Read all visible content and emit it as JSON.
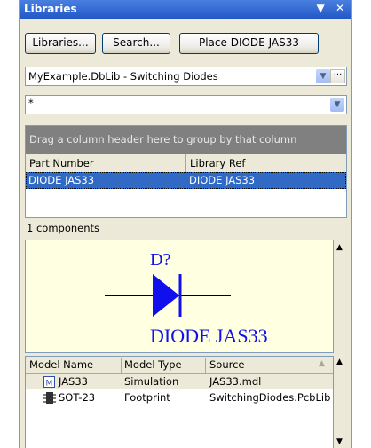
{
  "panel": {
    "title": "Libraries",
    "title_icons": "▼ ✕"
  },
  "toolbar": {
    "libraries_label": "Libraries...",
    "search_label": "Search...",
    "place_label": "Place DIODE JAS33"
  },
  "library_select": {
    "value": "MyExample.DbLib - Switching Diodes",
    "more_label": "···"
  },
  "filter_select": {
    "value": "*"
  },
  "grid": {
    "group_hint": "Drag a column header here to group by that column",
    "columns": [
      "Part Number",
      "Library Ref"
    ],
    "rows": [
      {
        "part_number": "DIODE JAS33",
        "library_ref": "DIODE JAS33"
      }
    ]
  },
  "component_count": "1 components",
  "preview": {
    "designator": "D?",
    "comment": "DIODE JAS33",
    "symbol_color": "#1010ee"
  },
  "models": {
    "columns": [
      "Model Name",
      "Model Type",
      "Source"
    ],
    "rows": [
      {
        "icon": "simulation-model-icon",
        "name": "JAS33",
        "type": "Simulation",
        "source": "JAS33.mdl"
      },
      {
        "icon": "footprint-chip-icon",
        "name": "SOT-23",
        "type": "Footprint",
        "source": "SwitchingDiodes.PcbLib"
      }
    ]
  }
}
